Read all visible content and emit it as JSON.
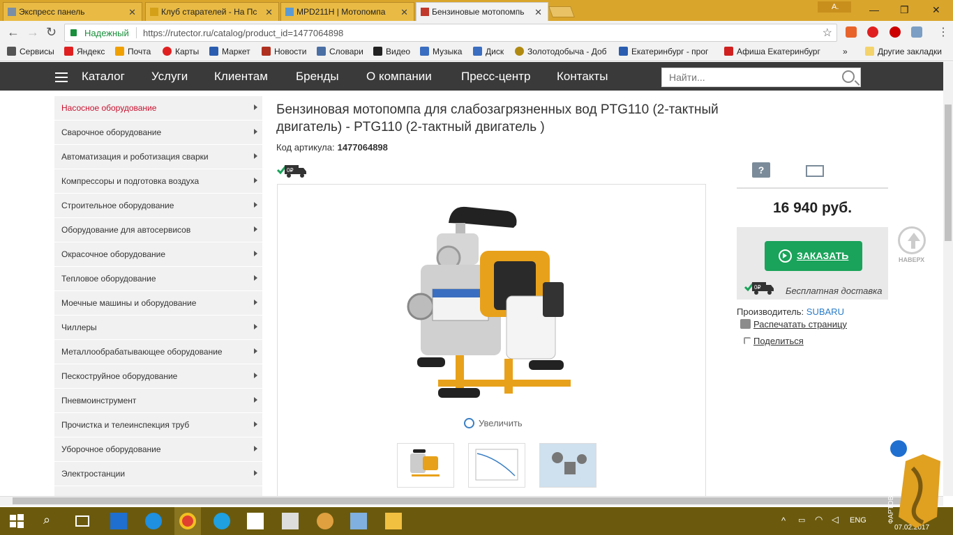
{
  "browser": {
    "tabs": [
      {
        "title": "Экспресс панель",
        "color": "#7a8fa6"
      },
      {
        "title": "Клуб старателей - На Пс",
        "color": "#d4a017"
      },
      {
        "title": "MPD211H | Мотопомпа",
        "color": "#5b9bd5"
      },
      {
        "title": "Бензиновые мотопомпь",
        "color": "#c0392b"
      }
    ],
    "user_chip": "A.",
    "secure_label": "Надежный",
    "url": "https://rutector.ru/catalog/product_id=1477064898",
    "bookmarks": [
      {
        "label": "Сервисы",
        "icon": "apps-icon",
        "color": "#555555"
      },
      {
        "label": "Яндекс",
        "icon": "yandex-icon",
        "color": "#e02020"
      },
      {
        "label": "Почта",
        "icon": "mail-icon",
        "color": "#f0a000"
      },
      {
        "label": "Карты",
        "icon": "map-pin-icon",
        "color": "#e02020"
      },
      {
        "label": "Маркет",
        "icon": "cart-icon",
        "color": "#2a5db0"
      },
      {
        "label": "Новости",
        "icon": "news-icon",
        "color": "#b03020"
      },
      {
        "label": "Словари",
        "icon": "dictionary-icon",
        "color": "#4a6fa5"
      },
      {
        "label": "Видео",
        "icon": "video-icon",
        "color": "#222222"
      },
      {
        "label": "Музыка",
        "icon": "music-icon",
        "color": "#3a6ec0"
      },
      {
        "label": "Диск",
        "icon": "disk-icon",
        "color": "#3a6ec0"
      },
      {
        "label": "Золотодобыча - Доб",
        "icon": "gold-icon",
        "color": "#b08a10"
      },
      {
        "label": "Екатеринбург - прог",
        "icon": "weather-icon",
        "color": "#2a5db0"
      },
      {
        "label": "Афиша Екатеринбург",
        "icon": "e1-icon",
        "color": "#d02020"
      }
    ],
    "bookmarks_more": "»",
    "other_bookmarks": "Другие закладки"
  },
  "site": {
    "nav": [
      "Каталог",
      "Услуги",
      "Клиентам",
      "Бренды",
      "О компании",
      "Пресс-центр",
      "Контакты"
    ],
    "search_placeholder": "Найти...",
    "categories": [
      "Насосное оборудование",
      "Сварочное оборудование",
      "Автоматизация и роботизация сварки",
      "Компрессоры и подготовка воздуха",
      "Строительное оборудование",
      "Оборудование для автосервисов",
      "Окрасочное оборудование",
      "Тепловое оборудование",
      "Моечные машины и оборудование",
      "Чиллеры",
      "Металлообрабатывающее оборудование",
      "Пескоструйное оборудование",
      "Пневмоинструмент",
      "Прочистка и телеинспекция труб",
      "Уборочное оборудование",
      "Электростанции"
    ],
    "accent": "#c8102e"
  },
  "product": {
    "title": "Бензиновая мотопомпа для слабозагрязненных вод PTG110 (2-тактный двигатель) - PTG110 (2-тактный двигатель )",
    "sku_label": "Код артикула:",
    "sku": "1477064898",
    "free_ship_badge": "0₽",
    "zoom_label": "Увеличить",
    "price": "16 940 руб.",
    "order_label": "ЗАКАЗАТЬ",
    "delivery_label": "Бесплатная доставка",
    "maker_label": "Производитель:",
    "maker": "SUBARU",
    "print_label": "Распечатать страницу",
    "share_label": "Поделиться",
    "up_label": "НАВЕРХ",
    "order_color": "#1aa35a"
  },
  "taskbar": {
    "lang": "ENG",
    "date": "07.02.2017",
    "mascot_text": "ФАРТОВЫЙ"
  }
}
